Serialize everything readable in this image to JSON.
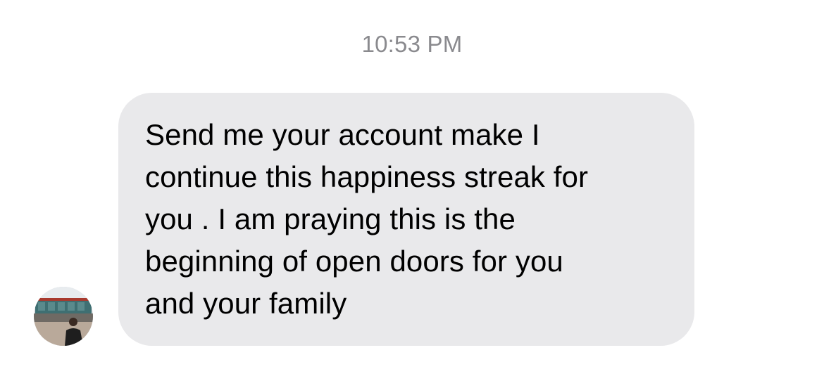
{
  "conversation": {
    "timestamp": "10:53 PM",
    "message": {
      "text": "Send me your account make I\ncontinue this happiness streak for\nyou . I am praying this is the\nbeginning of open doors for you\nand your family"
    }
  }
}
